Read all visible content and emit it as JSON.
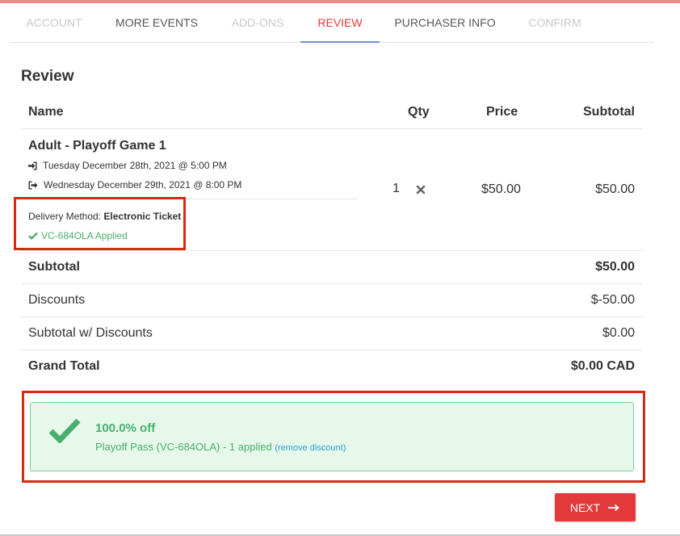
{
  "tabs": [
    {
      "label": "ACCOUNT",
      "state": "disabled"
    },
    {
      "label": "MORE EVENTS",
      "state": "enabled"
    },
    {
      "label": "ADD-ONS",
      "state": "disabled"
    },
    {
      "label": "REVIEW",
      "state": "active"
    },
    {
      "label": "PURCHASER INFO",
      "state": "enabled"
    },
    {
      "label": "CONFIRM",
      "state": "disabled"
    }
  ],
  "page": {
    "title": "Review"
  },
  "table": {
    "headers": {
      "name": "Name",
      "qty": "Qty",
      "price": "Price",
      "subtotal": "Subtotal"
    },
    "item": {
      "name": "Adult - Playoff Game 1",
      "start": "Tuesday December 28th, 2021 @ 5:00 PM",
      "end": "Wednesday December 29th, 2021 @ 8:00 PM",
      "delivery_label": "Delivery Method:",
      "delivery_value": "Electronic Ticket",
      "voucher_applied": "VC-684OLA Applied",
      "qty": "1",
      "price": "$50.00",
      "subtotal": "$50.00"
    }
  },
  "summary": {
    "subtotal_label": "Subtotal",
    "subtotal_value": "$50.00",
    "discounts_label": "Discounts",
    "discounts_value": "$-50.00",
    "after_discount_label": "Subtotal w/ Discounts",
    "after_discount_value": "$0.00",
    "grand_total_label": "Grand Total",
    "grand_total_value": "$0.00 CAD"
  },
  "discount": {
    "title": "100.0% off",
    "description": "Playoff Pass (VC-684OLA) - 1 applied",
    "remove_link": "(remove discount)"
  },
  "actions": {
    "next_label": "NEXT"
  },
  "icons": {
    "sign_in": "sign-in-icon",
    "sign_out": "sign-out-icon",
    "check": "check-icon",
    "remove": "times-icon",
    "arrow": "arrow-right-icon"
  },
  "colors": {
    "accent": "#e3393b",
    "success": "#4aaf6c",
    "link": "#2a9fd6",
    "highlight": "#d62a12"
  }
}
